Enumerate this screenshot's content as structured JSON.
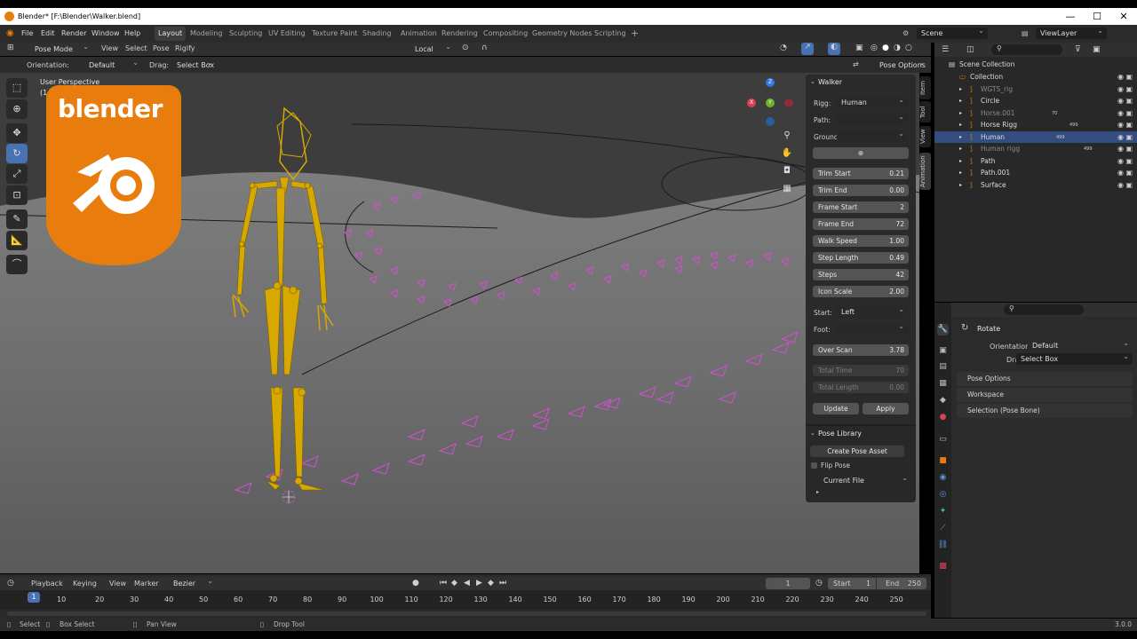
{
  "window": {
    "title": "Blender* [F:\\Blender\\Walker.blend]",
    "minimize": "—",
    "maximize": "☐",
    "close": "✕"
  },
  "menu": {
    "items": [
      "File",
      "Edit",
      "Render",
      "Window",
      "Help"
    ]
  },
  "workspaces": [
    "Layout",
    "Modeling",
    "Sculpting",
    "UV Editing",
    "Texture Paint",
    "Shading",
    "Animation",
    "Rendering",
    "Compositing",
    "Geometry Nodes",
    "Scripting"
  ],
  "workspace_add": "+",
  "scene": "Scene",
  "view_layer": "ViewLayer",
  "viewport_header": {
    "mode": "Pose Mode",
    "menus": [
      "View",
      "Select",
      "Pose",
      "Rigify"
    ],
    "transform_space": "Local",
    "orientation_label": "Orientation:",
    "orientation_value": "Default",
    "drag_label": "Drag:",
    "drag_value": "Select Box",
    "pose_options": "Pose Options"
  },
  "viewport": {
    "perspective": "User Perspective",
    "frame_info": "(1",
    "logo_text": "blender",
    "gizmo": {
      "x": "X",
      "y": "Y",
      "z": "Z"
    }
  },
  "walker_panel": {
    "title": "Walker",
    "rigg_label": "Rigg:",
    "rigg_value": "Human",
    "path_label": "Path:",
    "path_value": "",
    "ground_label": "Ground:",
    "ground_value": "",
    "fields": [
      {
        "label": "Trim Start",
        "value": "0.21"
      },
      {
        "label": "Trim End",
        "value": "0.00"
      },
      {
        "label": "Frame Start",
        "value": "2"
      },
      {
        "label": "Frame End",
        "value": "72"
      },
      {
        "label": "Walk Speed",
        "value": "1.00"
      },
      {
        "label": "Step Length",
        "value": "0.49"
      },
      {
        "label": "Steps",
        "value": "42"
      },
      {
        "label": "Icon Scale",
        "value": "2.00"
      }
    ],
    "start_label": "Start:",
    "start_value": "Left",
    "foot_label": "Foot:",
    "foot_value": "",
    "over_scan_label": "Over Scan",
    "over_scan_value": "3.78",
    "total_time_label": "Total Time",
    "total_time_value": "70",
    "total_length_label": "Total Length",
    "total_length_value": "0.00",
    "update": "Update",
    "apply": "Apply"
  },
  "pose_library": {
    "title": "Pose Library",
    "create": "Create Pose Asset",
    "flip": "Flip Pose",
    "source": "Current File"
  },
  "side_tabs": [
    "Item",
    "Tool",
    "View",
    "Animation"
  ],
  "outliner": {
    "scene_collection": "Scene Collection",
    "items": [
      {
        "name": "Collection",
        "indent": 1,
        "color": "#dcdcdc",
        "selected": false
      },
      {
        "name": "WGTS_rig",
        "indent": 2,
        "color": "#8a8a8a",
        "selected": false
      },
      {
        "name": "Circle",
        "indent": 2,
        "color": "#dcdcdc",
        "selected": false
      },
      {
        "name": "Horse.001",
        "indent": 2,
        "color": "#8a8a8a",
        "selected": false
      },
      {
        "name": "Horse Rigg",
        "indent": 2,
        "color": "#dcdcdc",
        "selected": false
      },
      {
        "name": "Human",
        "indent": 2,
        "color": "#dcdcdc",
        "selected": true
      },
      {
        "name": "Human rigg",
        "indent": 2,
        "color": "#8a8a8a",
        "selected": false
      },
      {
        "name": "Path",
        "indent": 2,
        "color": "#dcdcdc",
        "selected": false
      },
      {
        "name": "Path.001",
        "indent": 2,
        "color": "#dcdcdc",
        "selected": false
      },
      {
        "name": "Surface",
        "indent": 2,
        "color": "#dcdcdc",
        "selected": false
      }
    ],
    "badges": [
      "70",
      "499",
      "499",
      "499"
    ]
  },
  "properties": {
    "tool_name": "Rotate",
    "orientation_label": "Orientation",
    "orientation_value": "Default",
    "drag_label": "Drag:",
    "drag_value": "Select Box",
    "sections": [
      "Pose Options",
      "Workspace",
      "Selection (Pose Bone)"
    ]
  },
  "timeline": {
    "menus": [
      "Playback",
      "Keying",
      "View",
      "Marker"
    ],
    "interpolation": "Bezier",
    "current_frame": "1",
    "start_label": "Start",
    "start_value": "1",
    "end_label": "End",
    "end_value": "250",
    "ticks": [
      "1",
      "10",
      "20",
      "30",
      "40",
      "50",
      "60",
      "70",
      "80",
      "90",
      "100",
      "110",
      "120",
      "130",
      "140",
      "150",
      "160",
      "170",
      "180",
      "190",
      "200",
      "210",
      "220",
      "230",
      "240",
      "250"
    ]
  },
  "statusbar": {
    "select": "Select",
    "box_select": "Box Select",
    "pan": "Pan View",
    "drop": "Drop Tool",
    "version": "3.0.0"
  },
  "colors": {
    "accent": "#4772b3",
    "armature": "#d6a800",
    "path_markers": "#d24fd2",
    "logo": "#e87d0d"
  }
}
